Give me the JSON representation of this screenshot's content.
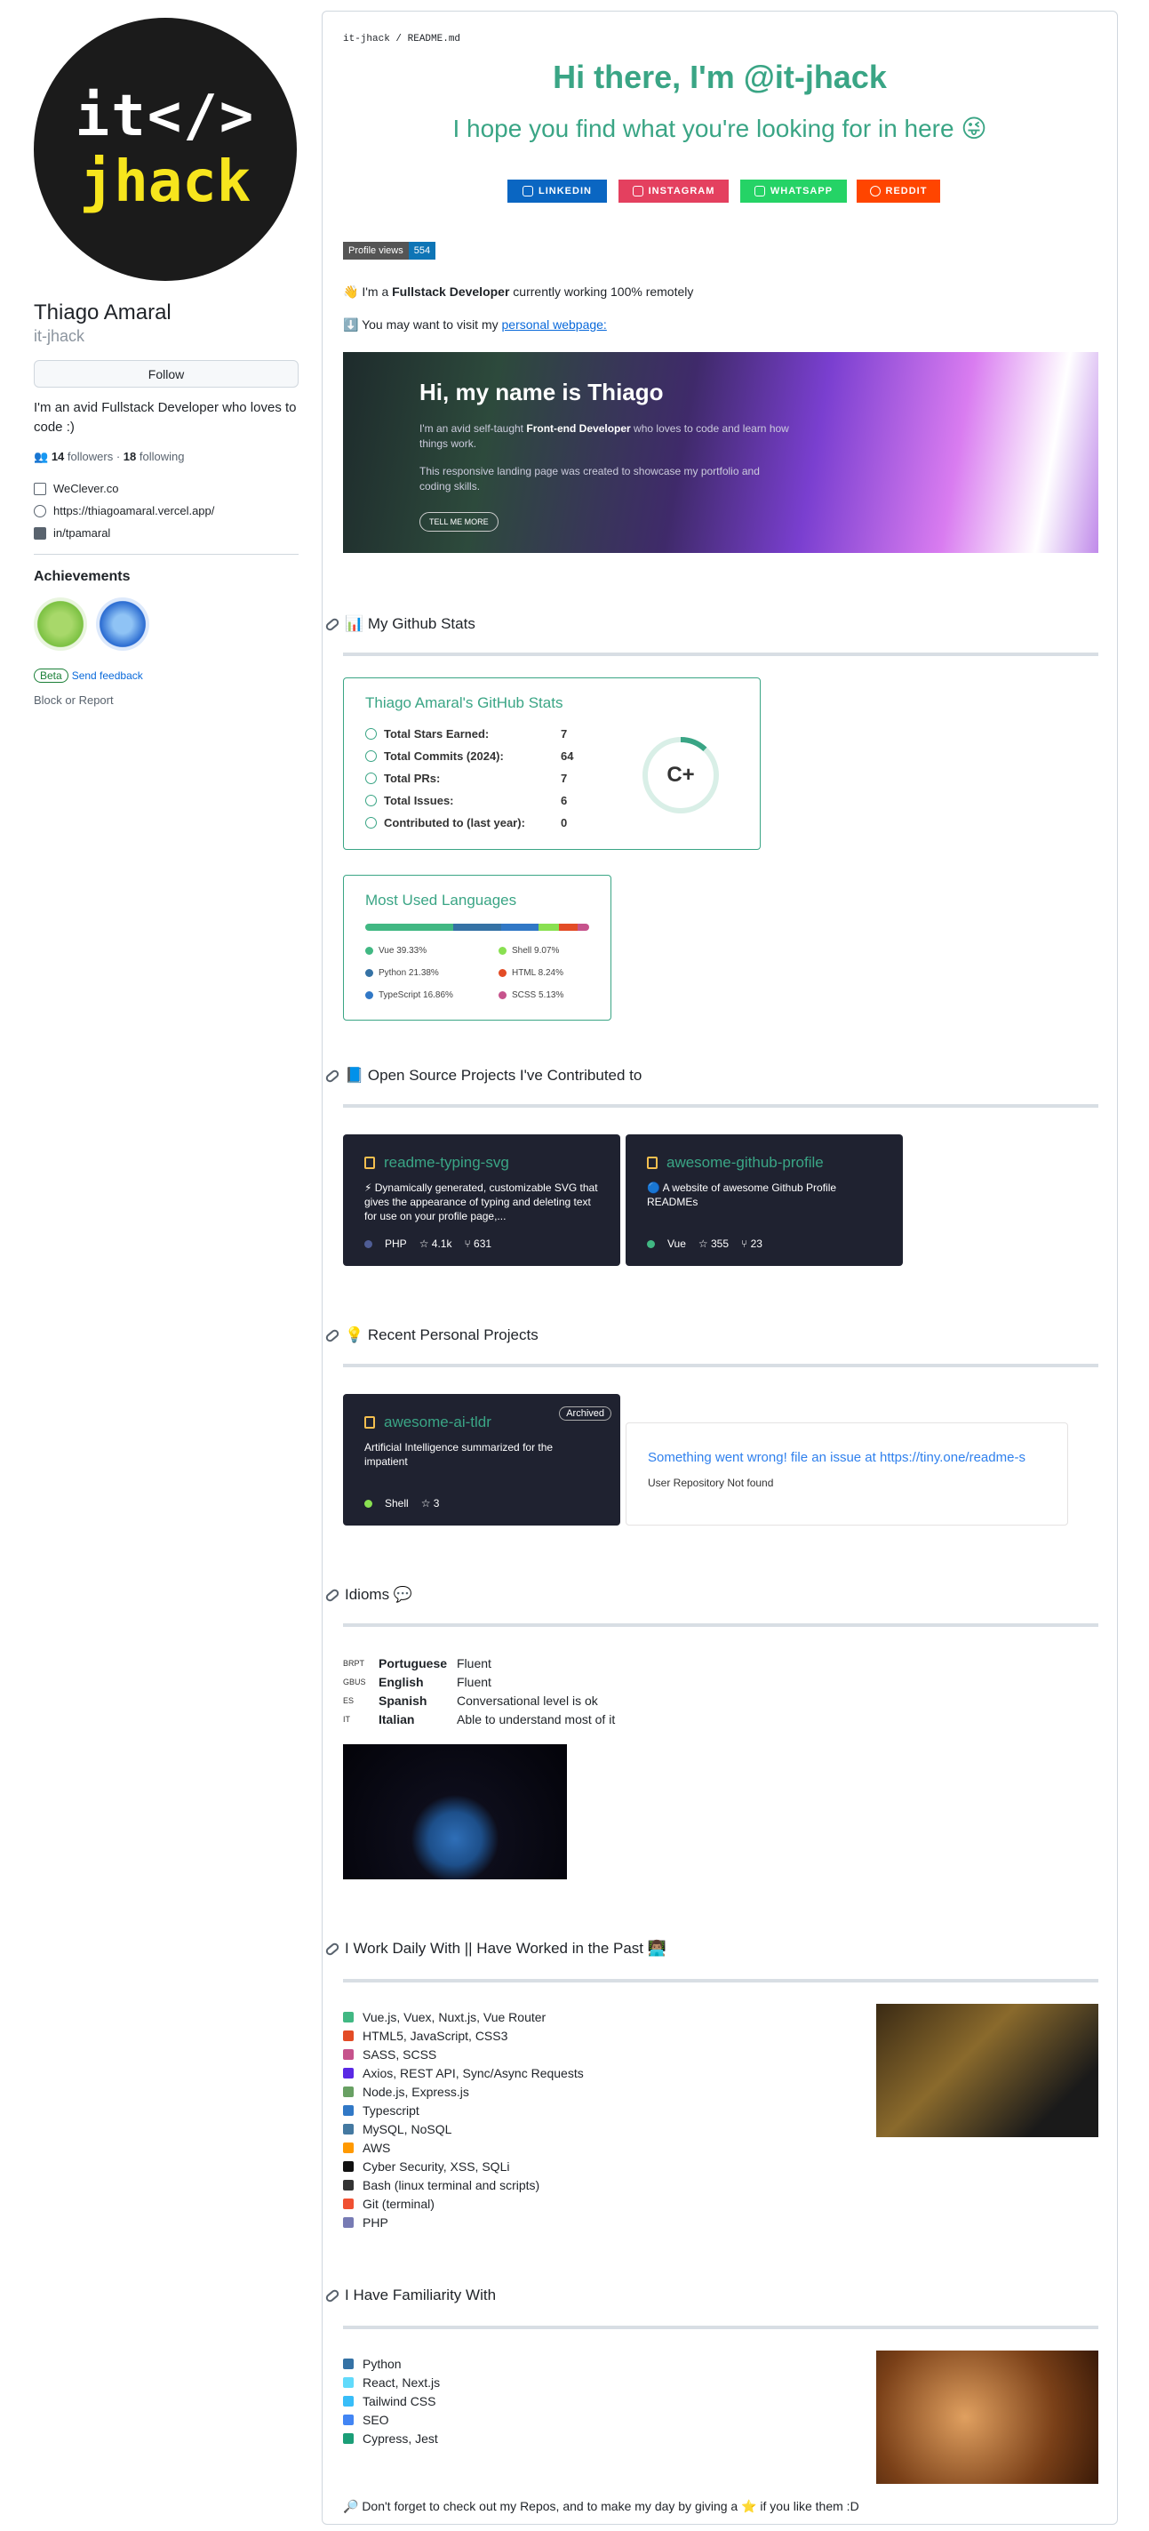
{
  "profile": {
    "name": "Thiago Amaral",
    "username": "it-jhack",
    "avatar_line1": "it</>",
    "avatar_line2": "jhack",
    "follow_label": "Follow",
    "bio": "I'm an avid Fullstack Developer who loves to code :)",
    "followers": "14",
    "followers_label": "followers",
    "following": "18",
    "following_label": "following",
    "links": [
      "WeClever.co",
      "https://thiagoamaral.vercel.app/",
      "in/tpamaral"
    ],
    "achievements_title": "Achievements",
    "beta": "Beta",
    "send_feedback": "Send feedback",
    "block": "Block or Report"
  },
  "readme": {
    "path": "it-jhack / README.md",
    "title": "Hi there, I'm @it-jhack",
    "subtitle": "I hope you find what you're looking for in here 😜",
    "shields": [
      {
        "label": "LINKEDIN",
        "color": "#0a66c2"
      },
      {
        "label": "INSTAGRAM",
        "color": "#e4405f"
      },
      {
        "label": "WHATSAPP",
        "color": "#25d366"
      },
      {
        "label": "REDDIT",
        "color": "#ff4500"
      }
    ],
    "profile_views_label": "Profile views",
    "profile_views": "554",
    "line1_pre": "I'm a ",
    "line1_bold": "Fullstack Developer",
    "line1_post": " currently working 100% remotely",
    "line2_pre": "You may want to visit my ",
    "line2_link": "personal webpage:",
    "hero": {
      "title": "Hi, my name is Thiago",
      "p1_pre": "I'm an avid self-taught ",
      "p1_bold": "Front-end Developer",
      "p1_post": " who loves to code and learn how things work.",
      "p2": "This responsive landing page was created to showcase my portfolio and coding skills.",
      "button": "TELL ME MORE"
    }
  },
  "stats_section": {
    "heading": "📊 My Github Stats",
    "card_title": "Thiago Amaral's GitHub Stats",
    "rows": [
      {
        "k": "Total Stars Earned:",
        "v": "7"
      },
      {
        "k": "Total Commits (2024):",
        "v": "64"
      },
      {
        "k": "Total PRs:",
        "v": "7"
      },
      {
        "k": "Total Issues:",
        "v": "6"
      },
      {
        "k": "Contributed to (last year):",
        "v": "0"
      }
    ],
    "grade": "C+",
    "rank_percent": 12
  },
  "langs": {
    "title": "Most Used Languages",
    "items": [
      {
        "name": "Vue 39.33%",
        "pct": 39.33,
        "color": "#41b883"
      },
      {
        "name": "Python 21.38%",
        "pct": 21.38,
        "color": "#3572a5"
      },
      {
        "name": "TypeScript 16.86%",
        "pct": 16.86,
        "color": "#3178c6"
      },
      {
        "name": "Shell 9.07%",
        "pct": 9.07,
        "color": "#89e051"
      },
      {
        "name": "HTML 8.24%",
        "pct": 8.24,
        "color": "#e34c26"
      },
      {
        "name": "SCSS 5.13%",
        "pct": 5.13,
        "color": "#c6538c"
      }
    ]
  },
  "oss": {
    "heading": "📘 Open Source Projects I've Contributed to",
    "repos": [
      {
        "name": "readme-typing-svg",
        "desc": "⚡ Dynamically generated, customizable SVG that gives the appearance of typing and deleting text for use on your profile page,...",
        "lang": "PHP",
        "lang_color": "#4f5d95",
        "stars": "4.1k",
        "forks": "631"
      },
      {
        "name": "awesome-github-profile",
        "desc": "🔵 A website of awesome Github Profile READMEs",
        "lang": "Vue",
        "lang_color": "#41b883",
        "stars": "355",
        "forks": "23"
      }
    ]
  },
  "personal": {
    "heading": "💡 Recent Personal Projects",
    "repo": {
      "name": "awesome-ai-tldr",
      "badge": "Archived",
      "desc": "Artificial Intelligence summarized for the impatient",
      "lang": "Shell",
      "lang_color": "#89e051",
      "stars": "3"
    },
    "error_title": "Something went wrong! file an issue at https://tiny.one/readme-s",
    "error_msg": "User Repository Not found"
  },
  "idioms": {
    "heading": "Idioms 💬",
    "rows": [
      {
        "c": "BRPT",
        "l": "Portuguese",
        "v": "Fluent"
      },
      {
        "c": "GBUS",
        "l": "English",
        "v": "Fluent"
      },
      {
        "c": "ES",
        "l": "Spanish",
        "v": "Conversational level is ok"
      },
      {
        "c": "IT",
        "l": "Italian",
        "v": "Able to understand most of it"
      }
    ]
  },
  "work": {
    "heading": "I Work Daily With  ||  Have Worked in the Past 👨🏽‍💻",
    "items": [
      {
        "t": "Vue.js, Vuex, Nuxt.js, Vue Router",
        "c": "#41b883"
      },
      {
        "t": "HTML5, JavaScript, CSS3",
        "c": "#e34c26"
      },
      {
        "t": "SASS, SCSS",
        "c": "#c6538c"
      },
      {
        "t": "Axios, REST API, Sync/Async Requests",
        "c": "#5a29e4"
      },
      {
        "t": "Node.js, Express.js",
        "c": "#68a063"
      },
      {
        "t": "Typescript",
        "c": "#3178c6"
      },
      {
        "t": "MySQL, NoSQL",
        "c": "#4479a1"
      },
      {
        "t": "AWS",
        "c": "#ff9900"
      },
      {
        "t": "Cyber Security, XSS, SQLi",
        "c": "#111111"
      },
      {
        "t": "Bash (linux terminal and scripts)",
        "c": "#333333"
      },
      {
        "t": "Git (terminal)",
        "c": "#f05032"
      },
      {
        "t": "PHP",
        "c": "#777bb4"
      }
    ]
  },
  "familiar": {
    "heading": "I Have Familiarity With",
    "items": [
      {
        "t": "Python",
        "c": "#3572a5"
      },
      {
        "t": "React, Next.js",
        "c": "#61dafb"
      },
      {
        "t": "Tailwind CSS",
        "c": "#38bdf8"
      },
      {
        "t": "SEO",
        "c": "#4285f4"
      },
      {
        "t": "Cypress, Jest",
        "c": "#1b9e77"
      }
    ]
  },
  "footer": "🔎 Don't forget to check out my Repos, and to make my day by giving a ⭐ if you like them :D"
}
